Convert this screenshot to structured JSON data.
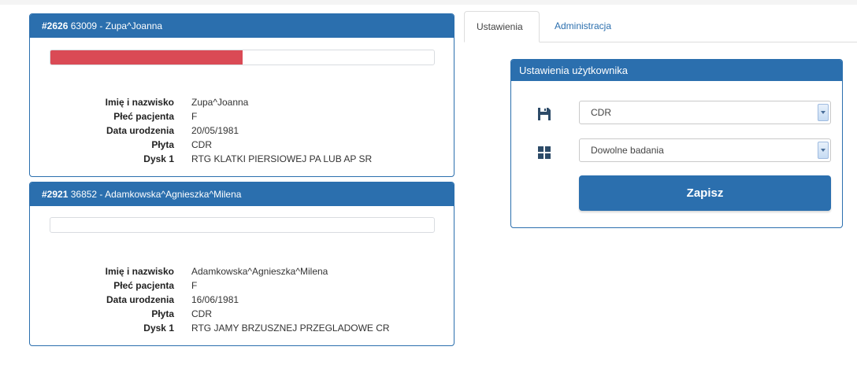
{
  "jobs": [
    {
      "id": "#2626",
      "title": "63009 - Zupa^Joanna",
      "progress": 0.5,
      "fields": [
        {
          "label": "Imię i nazwisko",
          "value": "Zupa^Joanna"
        },
        {
          "label": "Płeć pacjenta",
          "value": "F"
        },
        {
          "label": "Data urodzenia",
          "value": "20/05/1981"
        },
        {
          "label": "Płyta",
          "value": "CDR"
        },
        {
          "label": "Dysk 1",
          "value": "RTG KLATKI PIERSIOWEJ PA LUB AP SR"
        }
      ]
    },
    {
      "id": "#2921",
      "title": "36852 - Adamkowska^Agnieszka^Milena",
      "progress": 0,
      "fields": [
        {
          "label": "Imię i nazwisko",
          "value": "Adamkowska^Agnieszka^Milena"
        },
        {
          "label": "Płeć pacjenta",
          "value": "F"
        },
        {
          "label": "Data urodzenia",
          "value": "16/06/1981"
        },
        {
          "label": "Płyta",
          "value": "CDR"
        },
        {
          "label": "Dysk 1",
          "value": "RTG JAMY BRZUSZNEJ PRZEGLADOWE CR"
        }
      ]
    }
  ],
  "tabs": [
    {
      "label": "Ustawienia",
      "active": true
    },
    {
      "label": "Administracja",
      "active": false
    }
  ],
  "settings": {
    "title": "Ustawienia użytkownika",
    "media_select": {
      "icon": "floppy-disk-icon",
      "value": "CDR"
    },
    "study_select": {
      "icon": "grid-icon",
      "value": "Dowolne badania"
    },
    "save_label": "Zapisz"
  },
  "colors": {
    "primary": "#2b6fae",
    "progress": "#da4a55"
  }
}
